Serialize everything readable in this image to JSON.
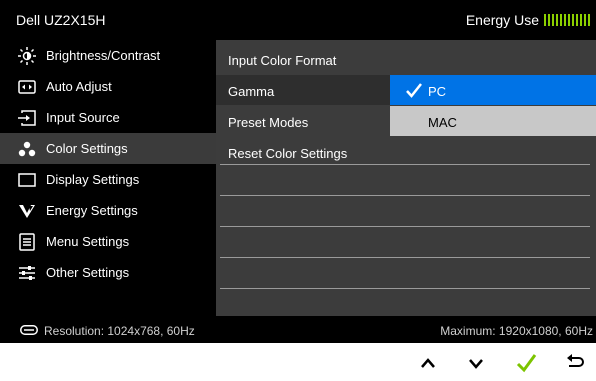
{
  "header": {
    "title": "Dell UZ2X15H",
    "energy_label": "Energy Use",
    "energy_bar_color": "#8cd000"
  },
  "menu": {
    "items": [
      {
        "label": "Brightness/Contrast",
        "icon": "brightness-icon"
      },
      {
        "label": "Auto Adjust",
        "icon": "auto-adjust-icon"
      },
      {
        "label": "Input Source",
        "icon": "input-source-icon"
      },
      {
        "label": "Color Settings",
        "icon": "color-settings-icon",
        "selected": true
      },
      {
        "label": "Display Settings",
        "icon": "display-settings-icon"
      },
      {
        "label": "Energy Settings",
        "icon": "energy-settings-icon"
      },
      {
        "label": "Menu Settings",
        "icon": "menu-settings-icon"
      },
      {
        "label": "Other Settings",
        "icon": "other-settings-icon"
      }
    ]
  },
  "panel": {
    "rows": [
      {
        "label": "Input Color Format"
      },
      {
        "label": "Gamma"
      },
      {
        "label": "Preset Modes"
      },
      {
        "label": "Reset Color Settings"
      }
    ],
    "options": {
      "pc_label": "PC",
      "mac_label": "MAC",
      "selected": "PC",
      "selected_color": "#0073e6"
    }
  },
  "status": {
    "resolution": "Resolution: 1024x768, 60Hz",
    "maximum": "Maximum: 1920x1080, 60Hz"
  },
  "keys": {
    "up": "up-arrow-icon",
    "down": "down-arrow-icon",
    "ok": "checkmark-icon",
    "back": "back-icon",
    "ok_color": "#7cc400"
  }
}
